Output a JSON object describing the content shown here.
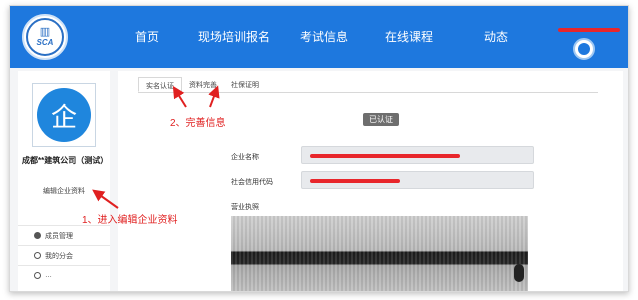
{
  "nav": {
    "logo_text": "SCA",
    "items": [
      {
        "label": "首页"
      },
      {
        "label": "现场培训报名"
      },
      {
        "label": "考试信息"
      },
      {
        "label": "在线课程"
      },
      {
        "label": "动态"
      }
    ]
  },
  "sidebar": {
    "company_logo_char": "企",
    "company_name": "成都**建筑公司（测试）",
    "edit_link": "编辑企业资料",
    "menu": [
      {
        "label": "成员管理"
      },
      {
        "label": "我的分会"
      },
      {
        "label": "…"
      }
    ]
  },
  "tabs": [
    {
      "label": "实名认证"
    },
    {
      "label": "资料完善"
    },
    {
      "label": "社保证明"
    }
  ],
  "main": {
    "status_badge": "已认证",
    "fields": [
      {
        "label": "企业名称"
      },
      {
        "label": "社会信用代码"
      }
    ],
    "license_label": "营业执照"
  },
  "annotations": {
    "step1": "1、进入编辑企业资料",
    "step2": "2、完善信息"
  },
  "colors": {
    "nav_bg": "#1e78de",
    "annotation": "#e02020",
    "redaction": "#e8262b"
  }
}
